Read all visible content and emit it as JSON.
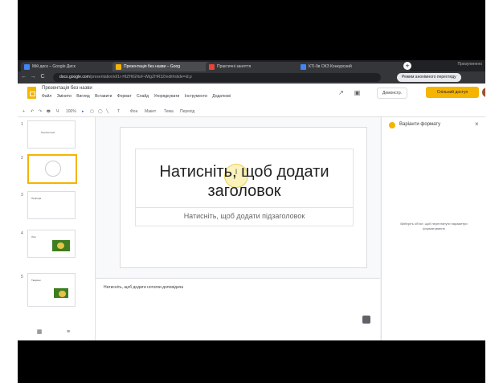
{
  "browser": {
    "tabs": [
      {
        "label": "Мій диск – Google Диск",
        "color": "#4285f4"
      },
      {
        "label": "Презентація без назви – Goog",
        "color": "#f4b400"
      },
      {
        "label": "Практичні заняття",
        "color": "#ea4335"
      },
      {
        "label": "КТІ-9в ОКЗ Конкурсний",
        "color": "#4285f4"
      }
    ],
    "new_tab_label": "+",
    "window_title": "Призупинено",
    "url_host": "docs.google.com",
    "url_rest": "/presentation/d/1r-HtZHtGNsF-WtgZHR3Z/edit#slide=id.p",
    "back": "←",
    "forward": "→",
    "reload": "C",
    "profile_button": "Режим анонімного перегляду"
  },
  "app": {
    "title": "Презентація без назви",
    "menu": [
      "Файл",
      "Змінити",
      "Вигляд",
      "Вставити",
      "Формат",
      "Слайд",
      "Упорядкувати",
      "Інструменти",
      "Додатковi"
    ],
    "show_button": "Демонстр.",
    "share_button": "Спільний доступ"
  },
  "toolbar": {
    "items": [
      "+",
      "↶",
      "↷",
      "🖶",
      "Ч",
      "100%",
      "▸",
      "▢",
      "◯",
      "╲",
      "T",
      "Фон",
      "Макет",
      "Тема",
      "Перехід"
    ]
  },
  "filmstrip": {
    "slides": [
      {
        "num": "1",
        "text": "Презентація"
      },
      {
        "num": "2",
        "text": ""
      },
      {
        "num": "3",
        "text": "Природа"
      },
      {
        "num": "4",
        "text": "Ліси"
      },
      {
        "num": "5",
        "text": "Тварини"
      }
    ],
    "grid_view": "▦",
    "list_view": "≡"
  },
  "slide": {
    "title_placeholder": "Натисніть, щоб додати заголовок",
    "subtitle_placeholder": "Натисніть, щоб додати підзаголовок",
    "cursor_mark": "I"
  },
  "notes": {
    "placeholder": "Натисніть, щоб додати нотатки доповідача"
  },
  "format_panel": {
    "title": "Варіанти формату",
    "close": "×",
    "hint": "Виберіть об'єкт, щоб переглянути параметри форматування"
  },
  "colors": {
    "accent": "#f4b400",
    "chrome_dark": "#202124"
  }
}
